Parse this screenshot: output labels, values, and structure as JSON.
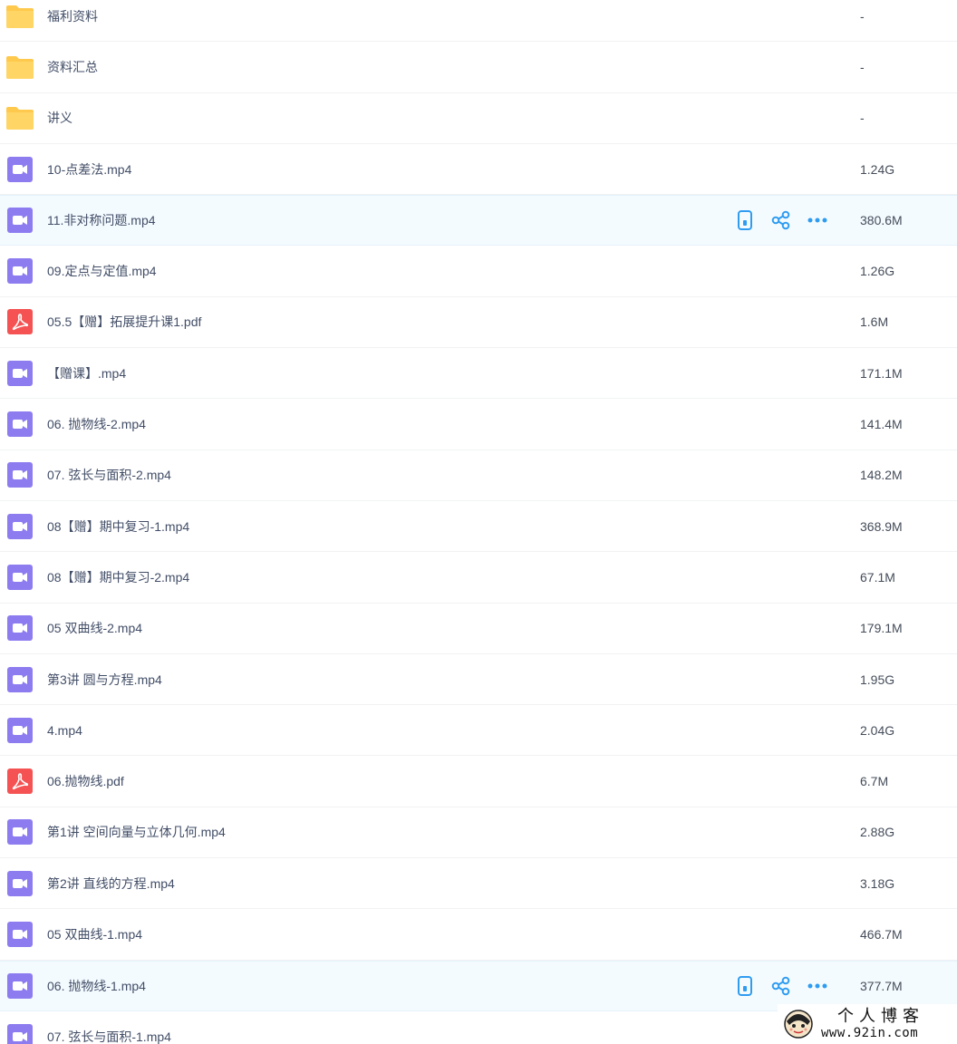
{
  "colors": {
    "folder": "#ffc94d",
    "video": "#8c7cf0",
    "pdf": "#f55353",
    "action": "#2f9cf0"
  },
  "files": [
    {
      "name": "福利资料",
      "size": "-",
      "type": "folder"
    },
    {
      "name": "资料汇总",
      "size": "-",
      "type": "folder"
    },
    {
      "name": "讲义",
      "size": "-",
      "type": "folder"
    },
    {
      "name": "10-点差法.mp4",
      "size": "1.24G",
      "type": "video"
    },
    {
      "name": "11.非对称问题.mp4",
      "size": "380.6M",
      "type": "video",
      "hovered": true
    },
    {
      "name": "09.定点与定值.mp4",
      "size": "1.26G",
      "type": "video"
    },
    {
      "name": "05.5【赠】拓展提升课1.pdf",
      "size": "1.6M",
      "type": "pdf"
    },
    {
      "name": "【赠课】.mp4",
      "size": "171.1M",
      "type": "video"
    },
    {
      "name": "06. 抛物线-2.mp4",
      "size": "141.4M",
      "type": "video"
    },
    {
      "name": "07. 弦长与面积-2.mp4",
      "size": "148.2M",
      "type": "video"
    },
    {
      "name": "08【赠】期中复习-1.mp4",
      "size": "368.9M",
      "type": "video"
    },
    {
      "name": "08【赠】期中复习-2.mp4",
      "size": "67.1M",
      "type": "video"
    },
    {
      "name": "05 双曲线-2.mp4",
      "size": "179.1M",
      "type": "video"
    },
    {
      "name": "第3讲 圆与方程.mp4",
      "size": "1.95G",
      "type": "video"
    },
    {
      "name": "4.mp4",
      "size": "2.04G",
      "type": "video"
    },
    {
      "name": "06.抛物线.pdf",
      "size": "6.7M",
      "type": "pdf"
    },
    {
      "name": "第1讲 空间向量与立体几何.mp4",
      "size": "2.88G",
      "type": "video"
    },
    {
      "name": "第2讲 直线的方程.mp4",
      "size": "3.18G",
      "type": "video"
    },
    {
      "name": "05 双曲线-1.mp4",
      "size": "466.7M",
      "type": "video"
    },
    {
      "name": "06. 抛物线-1.mp4",
      "size": "377.7M",
      "type": "video",
      "hovered": true
    },
    {
      "name": "07. 弦长与面积-1.mp4",
      "size": "",
      "type": "video"
    }
  ],
  "actions": [
    {
      "name": "phone-icon"
    },
    {
      "name": "share-icon"
    },
    {
      "name": "more-icon"
    }
  ],
  "watermark": {
    "title": "个人博客",
    "url": "www.92in.com"
  }
}
